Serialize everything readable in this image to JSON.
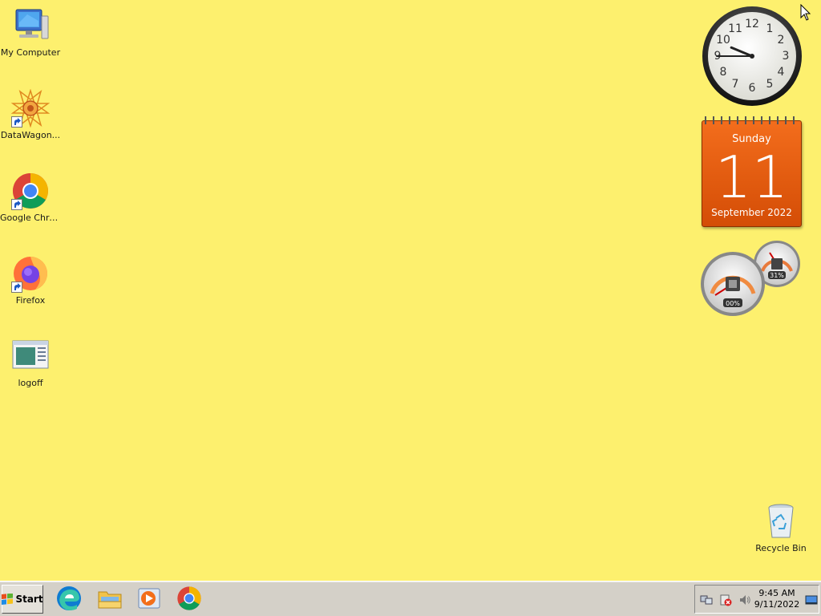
{
  "desktop": {
    "background_color": "#fdf06e",
    "icons": [
      {
        "label": "My Computer",
        "icon": "computer-icon",
        "shortcut": false
      },
      {
        "label": "DataWagon...",
        "icon": "datawagon-icon",
        "shortcut": true
      },
      {
        "label": "Google Chrome",
        "icon": "chrome-icon",
        "shortcut": true
      },
      {
        "label": "Firefox",
        "icon": "firefox-icon",
        "shortcut": true
      },
      {
        "label": "logoff",
        "icon": "logoff-icon",
        "shortcut": false
      }
    ],
    "recycle_bin": {
      "label": "Recycle Bin",
      "icon": "recycle-bin-icon"
    }
  },
  "gadgets": {
    "clock": {
      "hour": 9,
      "minute": 45
    },
    "calendar": {
      "weekday": "Sunday",
      "day": "11",
      "month_year": "September 2022",
      "color": "#e65c10"
    },
    "cpu_meter": {
      "cpu_percent": "00%",
      "memory_percent": "31%"
    }
  },
  "taskbar": {
    "start_label": "Start",
    "pinned_apps": [
      {
        "name": "Microsoft Edge",
        "icon": "edge-icon"
      },
      {
        "name": "File Explorer",
        "icon": "folder-icon"
      },
      {
        "name": "Media Player",
        "icon": "media-player-icon"
      },
      {
        "name": "Google Chrome",
        "icon": "chrome-icon"
      }
    ],
    "tray": {
      "icons": [
        "network-icon",
        "action-center-icon",
        "volume-icon",
        "show-desktop-icon"
      ],
      "time": "9:45 AM",
      "date": "9/11/2022"
    }
  }
}
